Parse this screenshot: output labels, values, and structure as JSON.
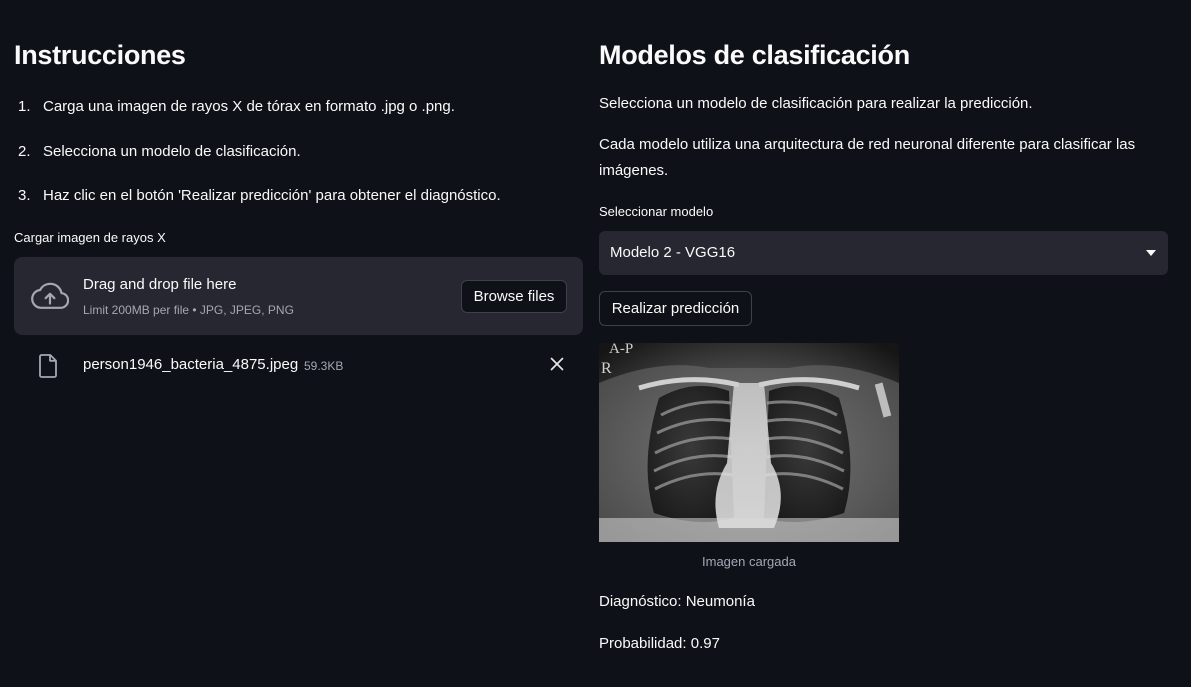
{
  "left": {
    "title": "Instrucciones",
    "steps": [
      {
        "num": "1.",
        "text": "Carga una imagen de rayos X de tórax en formato .jpg o .png."
      },
      {
        "num": "2.",
        "text": "Selecciona un modelo de clasificación."
      },
      {
        "num": "3.",
        "text": "Haz clic en el botón 'Realizar predicción' para obtener el diagnóstico."
      }
    ],
    "uploader": {
      "label": "Cargar imagen de rayos X",
      "title": "Drag and drop file here",
      "limit": "Limit 200MB per file • JPG, JPEG, PNG",
      "browse_label": "Browse files",
      "upload_icon": "cloud-upload-icon"
    },
    "file": {
      "name": "person1946_bacteria_4875.jpeg",
      "size": "59.3KB",
      "icon": "file-icon",
      "remove_icon": "close-icon"
    }
  },
  "right": {
    "title": "Modelos de clasificación",
    "intro": "Selecciona un modelo de clasificación para realizar la predicción.",
    "description": "Cada modelo utiliza una arquitectura de red neuronal diferente para clasificar las imágenes.",
    "select": {
      "label": "Seleccionar modelo",
      "value": "Modelo 2 - VGG16",
      "icon": "chevron-down-icon"
    },
    "predict_label": "Realizar predicción",
    "image": {
      "overlay_top": "A-P",
      "overlay_side": "R",
      "caption": "Imagen cargada"
    },
    "diagnosis": "Diagnóstico: Neumonía",
    "probability": "Probabilidad: 0.97"
  },
  "colors": {
    "background": "#0e1117",
    "surface": "#262730",
    "text": "#fafafa",
    "muted_text": "#a3a8b4",
    "button_border": "#3f4148"
  }
}
